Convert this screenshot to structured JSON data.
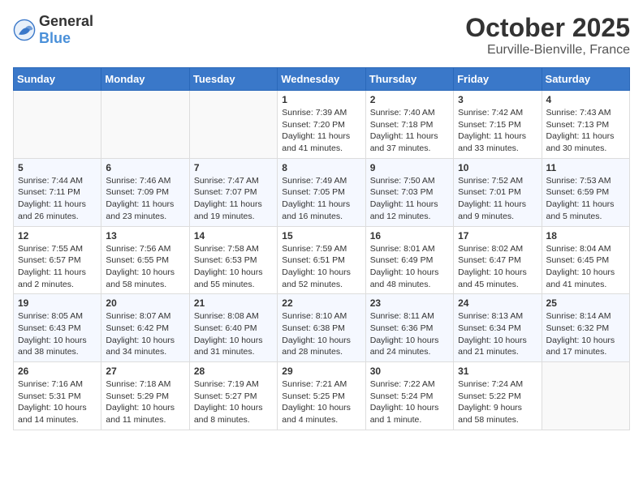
{
  "header": {
    "logo_general": "General",
    "logo_blue": "Blue",
    "month": "October 2025",
    "location": "Eurville-Bienville, France"
  },
  "days_of_week": [
    "Sunday",
    "Monday",
    "Tuesday",
    "Wednesday",
    "Thursday",
    "Friday",
    "Saturday"
  ],
  "weeks": [
    [
      {
        "day": "",
        "sunrise": "",
        "sunset": "",
        "daylight": ""
      },
      {
        "day": "",
        "sunrise": "",
        "sunset": "",
        "daylight": ""
      },
      {
        "day": "",
        "sunrise": "",
        "sunset": "",
        "daylight": ""
      },
      {
        "day": "1",
        "sunrise": "Sunrise: 7:39 AM",
        "sunset": "Sunset: 7:20 PM",
        "daylight": "Daylight: 11 hours and 41 minutes."
      },
      {
        "day": "2",
        "sunrise": "Sunrise: 7:40 AM",
        "sunset": "Sunset: 7:18 PM",
        "daylight": "Daylight: 11 hours and 37 minutes."
      },
      {
        "day": "3",
        "sunrise": "Sunrise: 7:42 AM",
        "sunset": "Sunset: 7:15 PM",
        "daylight": "Daylight: 11 hours and 33 minutes."
      },
      {
        "day": "4",
        "sunrise": "Sunrise: 7:43 AM",
        "sunset": "Sunset: 7:13 PM",
        "daylight": "Daylight: 11 hours and 30 minutes."
      }
    ],
    [
      {
        "day": "5",
        "sunrise": "Sunrise: 7:44 AM",
        "sunset": "Sunset: 7:11 PM",
        "daylight": "Daylight: 11 hours and 26 minutes."
      },
      {
        "day": "6",
        "sunrise": "Sunrise: 7:46 AM",
        "sunset": "Sunset: 7:09 PM",
        "daylight": "Daylight: 11 hours and 23 minutes."
      },
      {
        "day": "7",
        "sunrise": "Sunrise: 7:47 AM",
        "sunset": "Sunset: 7:07 PM",
        "daylight": "Daylight: 11 hours and 19 minutes."
      },
      {
        "day": "8",
        "sunrise": "Sunrise: 7:49 AM",
        "sunset": "Sunset: 7:05 PM",
        "daylight": "Daylight: 11 hours and 16 minutes."
      },
      {
        "day": "9",
        "sunrise": "Sunrise: 7:50 AM",
        "sunset": "Sunset: 7:03 PM",
        "daylight": "Daylight: 11 hours and 12 minutes."
      },
      {
        "day": "10",
        "sunrise": "Sunrise: 7:52 AM",
        "sunset": "Sunset: 7:01 PM",
        "daylight": "Daylight: 11 hours and 9 minutes."
      },
      {
        "day": "11",
        "sunrise": "Sunrise: 7:53 AM",
        "sunset": "Sunset: 6:59 PM",
        "daylight": "Daylight: 11 hours and 5 minutes."
      }
    ],
    [
      {
        "day": "12",
        "sunrise": "Sunrise: 7:55 AM",
        "sunset": "Sunset: 6:57 PM",
        "daylight": "Daylight: 11 hours and 2 minutes."
      },
      {
        "day": "13",
        "sunrise": "Sunrise: 7:56 AM",
        "sunset": "Sunset: 6:55 PM",
        "daylight": "Daylight: 10 hours and 58 minutes."
      },
      {
        "day": "14",
        "sunrise": "Sunrise: 7:58 AM",
        "sunset": "Sunset: 6:53 PM",
        "daylight": "Daylight: 10 hours and 55 minutes."
      },
      {
        "day": "15",
        "sunrise": "Sunrise: 7:59 AM",
        "sunset": "Sunset: 6:51 PM",
        "daylight": "Daylight: 10 hours and 52 minutes."
      },
      {
        "day": "16",
        "sunrise": "Sunrise: 8:01 AM",
        "sunset": "Sunset: 6:49 PM",
        "daylight": "Daylight: 10 hours and 48 minutes."
      },
      {
        "day": "17",
        "sunrise": "Sunrise: 8:02 AM",
        "sunset": "Sunset: 6:47 PM",
        "daylight": "Daylight: 10 hours and 45 minutes."
      },
      {
        "day": "18",
        "sunrise": "Sunrise: 8:04 AM",
        "sunset": "Sunset: 6:45 PM",
        "daylight": "Daylight: 10 hours and 41 minutes."
      }
    ],
    [
      {
        "day": "19",
        "sunrise": "Sunrise: 8:05 AM",
        "sunset": "Sunset: 6:43 PM",
        "daylight": "Daylight: 10 hours and 38 minutes."
      },
      {
        "day": "20",
        "sunrise": "Sunrise: 8:07 AM",
        "sunset": "Sunset: 6:42 PM",
        "daylight": "Daylight: 10 hours and 34 minutes."
      },
      {
        "day": "21",
        "sunrise": "Sunrise: 8:08 AM",
        "sunset": "Sunset: 6:40 PM",
        "daylight": "Daylight: 10 hours and 31 minutes."
      },
      {
        "day": "22",
        "sunrise": "Sunrise: 8:10 AM",
        "sunset": "Sunset: 6:38 PM",
        "daylight": "Daylight: 10 hours and 28 minutes."
      },
      {
        "day": "23",
        "sunrise": "Sunrise: 8:11 AM",
        "sunset": "Sunset: 6:36 PM",
        "daylight": "Daylight: 10 hours and 24 minutes."
      },
      {
        "day": "24",
        "sunrise": "Sunrise: 8:13 AM",
        "sunset": "Sunset: 6:34 PM",
        "daylight": "Daylight: 10 hours and 21 minutes."
      },
      {
        "day": "25",
        "sunrise": "Sunrise: 8:14 AM",
        "sunset": "Sunset: 6:32 PM",
        "daylight": "Daylight: 10 hours and 17 minutes."
      }
    ],
    [
      {
        "day": "26",
        "sunrise": "Sunrise: 7:16 AM",
        "sunset": "Sunset: 5:31 PM",
        "daylight": "Daylight: 10 hours and 14 minutes."
      },
      {
        "day": "27",
        "sunrise": "Sunrise: 7:18 AM",
        "sunset": "Sunset: 5:29 PM",
        "daylight": "Daylight: 10 hours and 11 minutes."
      },
      {
        "day": "28",
        "sunrise": "Sunrise: 7:19 AM",
        "sunset": "Sunset: 5:27 PM",
        "daylight": "Daylight: 10 hours and 8 minutes."
      },
      {
        "day": "29",
        "sunrise": "Sunrise: 7:21 AM",
        "sunset": "Sunset: 5:25 PM",
        "daylight": "Daylight: 10 hours and 4 minutes."
      },
      {
        "day": "30",
        "sunrise": "Sunrise: 7:22 AM",
        "sunset": "Sunset: 5:24 PM",
        "daylight": "Daylight: 10 hours and 1 minute."
      },
      {
        "day": "31",
        "sunrise": "Sunrise: 7:24 AM",
        "sunset": "Sunset: 5:22 PM",
        "daylight": "Daylight: 9 hours and 58 minutes."
      },
      {
        "day": "",
        "sunrise": "",
        "sunset": "",
        "daylight": ""
      }
    ]
  ]
}
